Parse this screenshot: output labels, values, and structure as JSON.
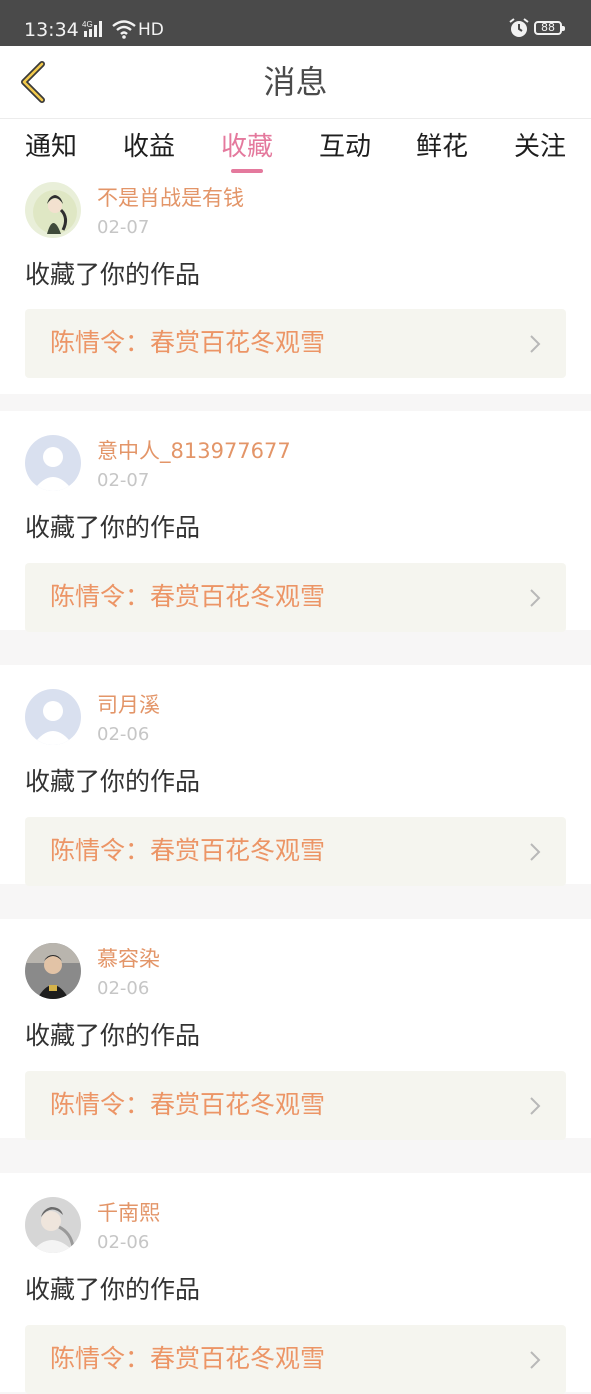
{
  "status_bar": {
    "time": "13:34",
    "network": "4G",
    "hd": "HD",
    "battery": "88"
  },
  "header": {
    "title": "消息",
    "back_icon": "chevron-left-icon"
  },
  "tabs": [
    {
      "label": "通知",
      "active": false
    },
    {
      "label": "收益",
      "active": false
    },
    {
      "label": "收藏",
      "active": true
    },
    {
      "label": "互动",
      "active": false
    },
    {
      "label": "鲜花",
      "active": false
    },
    {
      "label": "关注",
      "active": false
    }
  ],
  "colors": {
    "accent": "#e4799d",
    "username": "#e39568",
    "work_title": "#ec9566",
    "work_bg": "#f5f5ef",
    "header_bg": "#ffffff",
    "status_bar": "#4a4a4a"
  },
  "messages": [
    {
      "username": "不是肖战是有钱",
      "date": "02-07",
      "action": "收藏了你的作品",
      "work": "陈情令：春赏百花冬观雪",
      "avatar": "illustrated-avatar"
    },
    {
      "username": "意中人_813977677",
      "date": "02-07",
      "action": "收藏了你的作品",
      "work": "陈情令：春赏百花冬观雪",
      "avatar": "default-avatar"
    },
    {
      "username": "司月溪",
      "date": "02-06",
      "action": "收藏了你的作品",
      "work": "陈情令：春赏百花冬观雪",
      "avatar": "default-avatar"
    },
    {
      "username": "慕容染",
      "date": "02-06",
      "action": "收藏了你的作品",
      "work": "陈情令：春赏百花冬观雪",
      "avatar": "photo-avatar"
    },
    {
      "username": "千南熙",
      "date": "02-06",
      "action": "收藏了你的作品",
      "work": "陈情令：春赏百花冬观雪",
      "avatar": "photo-avatar"
    }
  ]
}
